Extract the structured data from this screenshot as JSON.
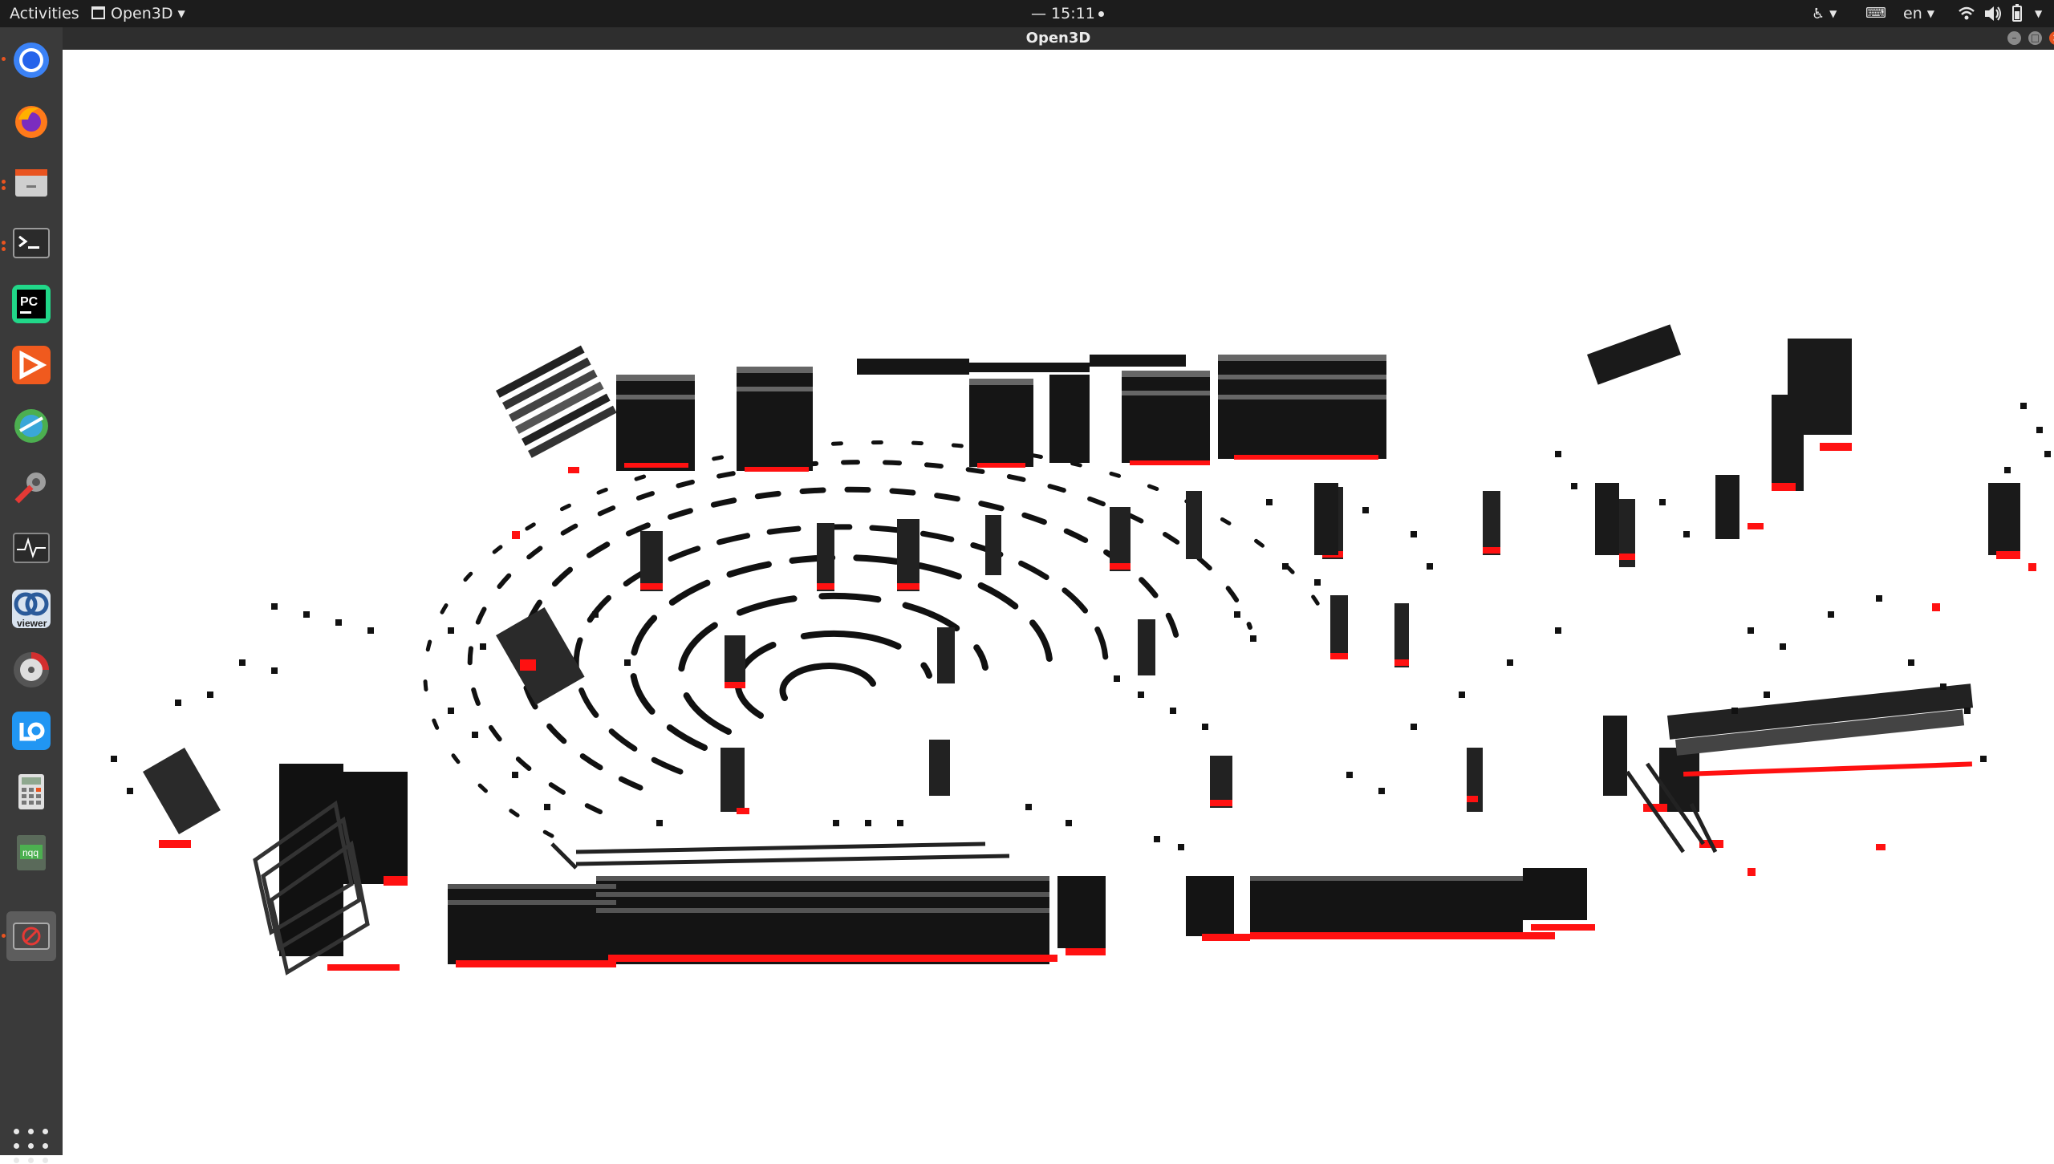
{
  "topbar": {
    "activities": "Activities",
    "app_name": "Open3D",
    "clock": "— 15:11",
    "lang": "en",
    "icons": [
      "accessibility-icon",
      "keyboard-icon",
      "wifi-icon",
      "volume-icon",
      "battery-icon",
      "system-menu-icon"
    ]
  },
  "window": {
    "title": "Open3D",
    "background": "#ffffff"
  },
  "dock": {
    "apps": [
      "Chromium",
      "Firefox",
      "Files",
      "Terminal",
      "PyCharm",
      "Presentation",
      "Network Monitor",
      "Settings",
      "System Monitor",
      "CloudCompare viewer",
      "Disk Usage",
      "Bookworm",
      "Calculator",
      "NQQ",
      "Open3D"
    ],
    "cc_viewer_label": "viewer",
    "nqq_label": "nqq",
    "pycharm_label": "PC"
  },
  "colors": {
    "points": "#111111",
    "ground_points": "#ff0000",
    "accent": "#e95420"
  }
}
